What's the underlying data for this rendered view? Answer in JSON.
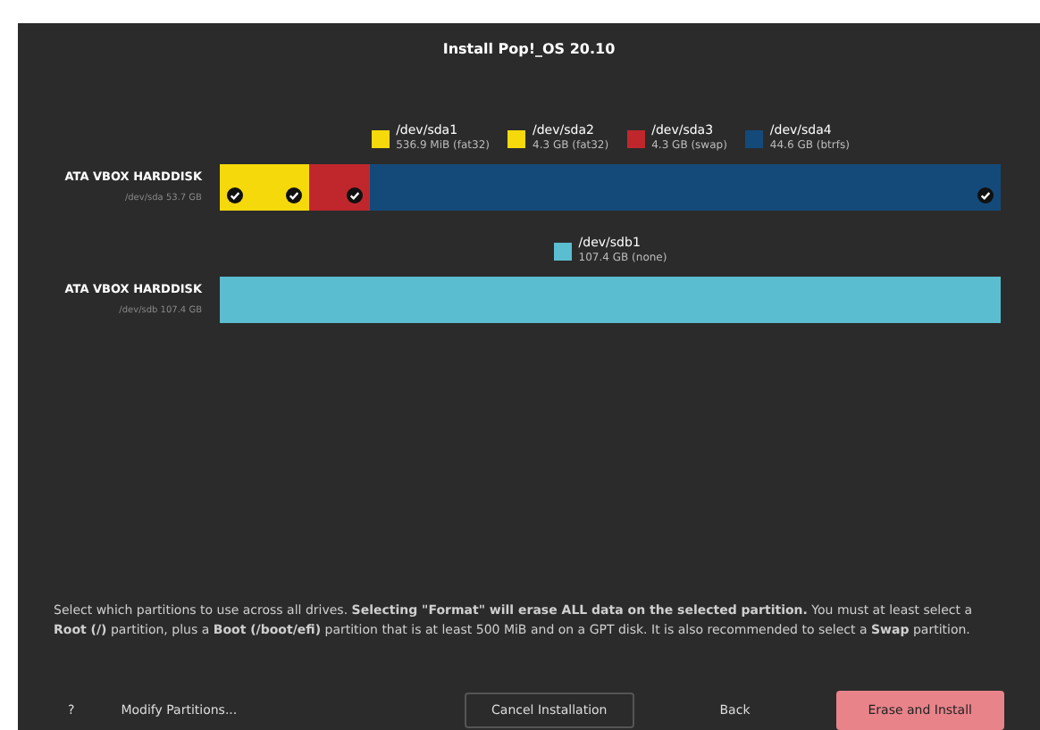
{
  "window": {
    "title": "Install Pop!_OS 20.10"
  },
  "disks": [
    {
      "name": "ATA VBOX HARDDISK",
      "detail": "/dev/sda 53.7 GB",
      "partitions": [
        {
          "path": "/dev/sda1",
          "info": "536.9 MiB (fat32)",
          "color": "#f5d90a",
          "checked": true
        },
        {
          "path": "/dev/sda2",
          "info": "4.3 GB (fat32)",
          "color": "#f5d90a",
          "checked": true
        },
        {
          "path": "/dev/sda3",
          "info": "4.3 GB (swap)",
          "color": "#c0272d",
          "checked": true
        },
        {
          "path": "/dev/sda4",
          "info": "44.6 GB (btrfs)",
          "color": "#134a7a",
          "checked": true
        }
      ]
    },
    {
      "name": "ATA VBOX HARDDISK",
      "detail": "/dev/sdb 107.4 GB",
      "partitions": [
        {
          "path": "/dev/sdb1",
          "info": "107.4 GB (none)",
          "color": "#5bbdd0",
          "checked": false
        }
      ]
    }
  ],
  "description": "Select which partitions to use across all drives. **Selecting \"Format\" will erase ALL data on the selected partition.** You must at least select a **Root (/)** partition, plus a **Boot (/boot/efi)** partition that is at least 500 MiB and on a GPT disk. It is also recommended to select a **Swap** partition.",
  "buttons": [
    {
      "label": "?",
      "kind": "plain"
    },
    {
      "label": "Modify Partitions...",
      "kind": "plain"
    },
    {
      "label": "Cancel Installation",
      "kind": "outlined"
    },
    {
      "label": "Back",
      "kind": "plain"
    },
    {
      "label": "Erase and Install",
      "kind": "destructive"
    }
  ]
}
